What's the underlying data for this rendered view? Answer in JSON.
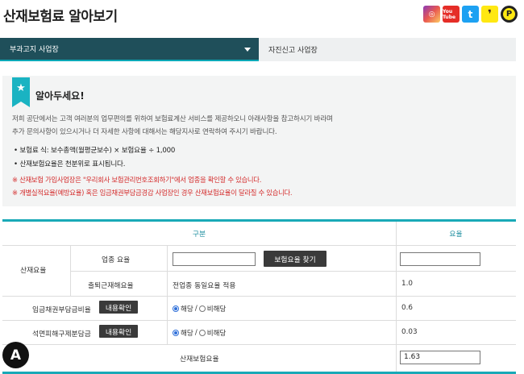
{
  "page": {
    "title": "산재보험료 알아보기"
  },
  "social": [
    {
      "name": "instagram",
      "glyph": "◎"
    },
    {
      "name": "youtube",
      "glyph": "You Tube"
    },
    {
      "name": "twitter",
      "glyph": "t"
    },
    {
      "name": "kakaotalk",
      "glyph": "❜"
    },
    {
      "name": "kakaostory",
      "glyph": "P"
    }
  ],
  "tabs": {
    "active": "부과고지 사업장",
    "inactive": "자진신고 사업장"
  },
  "notice": {
    "title": "알아두세요!",
    "line1": "저희 공단에서는 고객 여러분의 업무편의를 위하여 보험료계산 서비스를 제공하오니 아래사항을 참고하시기 바라며",
    "line2": "추가 문의사항이 있으시거나 더 자세한 사항에 대해서는 해당지사로 연락하여 주시기 바랍니다.",
    "bullet1": "• 보험료 식: 보수총액(월평균보수) × 보험요율 ÷ 1,000",
    "bullet2": "• 산재보험요율은 천분위로 표시됩니다.",
    "red1": "※ 산재보험 가입사업장은 \"우리회사 보험관리번호조회하기\"에서 업종을 확인할 수 있습니다.",
    "red2": "※ 개별실적요율(예방요율) 혹은 임금채권부담금경감 사업장인 경우 산재보험요율이 달라질 수 있습니다."
  },
  "table": {
    "header_category": "구분",
    "header_rate": "요율",
    "group_label": "산재요율",
    "row_industry": {
      "label": "업종 요율",
      "input_value": "",
      "button": "보험요율 찾기",
      "rate_value": ""
    },
    "row_commute": {
      "label": "출퇴근재해요율",
      "desc": "전업종 동일요율 적용",
      "rate": "1.0"
    },
    "row_wage": {
      "label": "임금채권부담금비율",
      "button": "내용확인",
      "yes": "해당",
      "no": "비해당",
      "rate": "0.6"
    },
    "row_asbestos": {
      "label": "석면피해구제분담금",
      "button": "내용확인",
      "yes": "해당",
      "no": "비해당",
      "rate": "0.03"
    },
    "row_total": {
      "label": "산재보험요율",
      "rate": "1.63"
    }
  },
  "logo": {
    "glyph": "A"
  }
}
